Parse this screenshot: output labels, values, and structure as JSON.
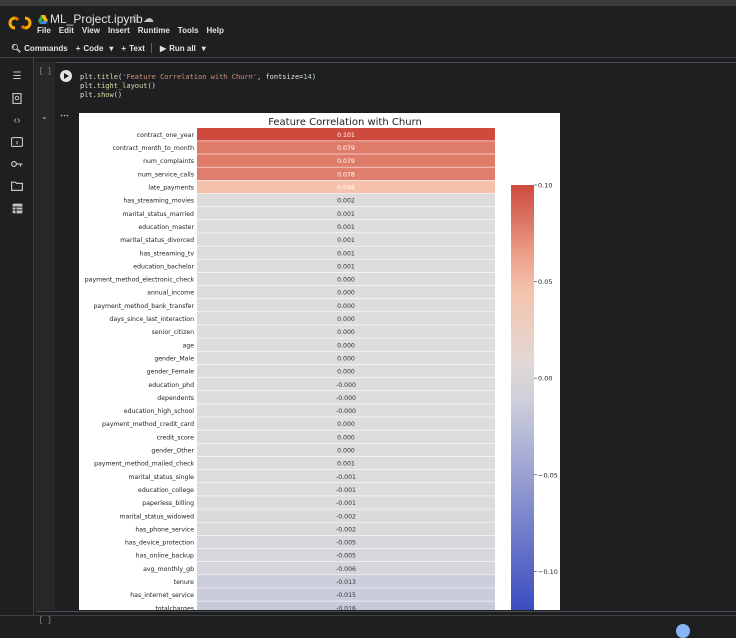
{
  "notebook": {
    "title": "ML_Project.ipynb"
  },
  "menu": [
    "File",
    "Edit",
    "View",
    "Insert",
    "Runtime",
    "Tools",
    "Help"
  ],
  "toolbar": {
    "commands": "Commands",
    "code": "Code",
    "text": "Text",
    "run_all": "Run all"
  },
  "sidebar_icons": [
    "table-of-contents-icon",
    "find-icon",
    "code-snippets-icon",
    "variables-icon",
    "secrets-icon",
    "files-icon",
    "terminal-icon"
  ],
  "cell": {
    "bracket": "[ ]",
    "code_lines": [
      "plt.title('Feature Correlation with Churn', fontsize=14)",
      "plt.tight_layout()",
      "plt.show()"
    ],
    "bottom_bracket": "[ ]"
  },
  "chart_data": {
    "type": "heatmap",
    "title": "Feature Correlation with Churn",
    "colorbar": {
      "min": -0.12,
      "max": 0.1,
      "ticks": [
        "0.10",
        "0.05",
        "0.00",
        "−0.05",
        "−0.10"
      ],
      "tick_values": [
        0.1,
        0.05,
        0.0,
        -0.05,
        -0.1
      ],
      "colormap": "coolwarm"
    },
    "rows": [
      {
        "label": "contract_one_year",
        "value": 0.101,
        "text": "0.101"
      },
      {
        "label": "contract_month_to_month",
        "value": 0.079,
        "text": "0.079"
      },
      {
        "label": "num_complaints",
        "value": 0.079,
        "text": "0.079"
      },
      {
        "label": "num_service_calls",
        "value": 0.078,
        "text": "0.078"
      },
      {
        "label": "late_payments",
        "value": 0.048,
        "text": "0.048"
      },
      {
        "label": "has_streaming_movies",
        "value": 0.002,
        "text": "0.002"
      },
      {
        "label": "marital_status_married",
        "value": 0.001,
        "text": "0.001"
      },
      {
        "label": "education_master",
        "value": 0.001,
        "text": "0.001"
      },
      {
        "label": "marital_status_divorced",
        "value": 0.001,
        "text": "0.001"
      },
      {
        "label": "has_streaming_tv",
        "value": 0.001,
        "text": "0.001"
      },
      {
        "label": "education_bachelor",
        "value": 0.001,
        "text": "0.001"
      },
      {
        "label": "payment_method_electronic_check",
        "value": 0.0,
        "text": "0.000"
      },
      {
        "label": "annual_income",
        "value": 0.0,
        "text": "0.000"
      },
      {
        "label": "payment_method_bank_transfer",
        "value": 0.0,
        "text": "0.000"
      },
      {
        "label": "days_since_last_interaction",
        "value": 0.0,
        "text": "0.000"
      },
      {
        "label": "senior_citizen",
        "value": 0.0,
        "text": "0.000"
      },
      {
        "label": "age",
        "value": 0.0,
        "text": "0.000"
      },
      {
        "label": "gender_Male",
        "value": 0.0,
        "text": "0.000"
      },
      {
        "label": "gender_Female",
        "value": 0.0,
        "text": "0.000"
      },
      {
        "label": "education_phd",
        "value": 0.0,
        "text": "-0.000"
      },
      {
        "label": "dependents",
        "value": 0.0,
        "text": "-0.000"
      },
      {
        "label": "education_high_school",
        "value": 0.0,
        "text": "-0.000"
      },
      {
        "label": "payment_method_credit_card",
        "value": 0.0,
        "text": "0.000"
      },
      {
        "label": "credit_score",
        "value": 0.0,
        "text": "0.000"
      },
      {
        "label": "gender_Other",
        "value": 0.0,
        "text": "0.000"
      },
      {
        "label": "payment_method_mailed_check",
        "value": -0.001,
        "text": "0.001"
      },
      {
        "label": "marital_status_single",
        "value": -0.001,
        "text": "-0.001"
      },
      {
        "label": "education_college",
        "value": -0.001,
        "text": "-0.001"
      },
      {
        "label": "paperless_billing",
        "value": -0.001,
        "text": "-0.001"
      },
      {
        "label": "marital_status_widowed",
        "value": -0.002,
        "text": "-0.002"
      },
      {
        "label": "has_phone_service",
        "value": -0.002,
        "text": "-0.002"
      },
      {
        "label": "has_device_protection",
        "value": -0.005,
        "text": "-0.005"
      },
      {
        "label": "has_online_backup",
        "value": -0.005,
        "text": "-0.005"
      },
      {
        "label": "avg_monthly_gb",
        "value": -0.006,
        "text": "-0.006"
      },
      {
        "label": "tenure",
        "value": -0.013,
        "text": "-0.013"
      },
      {
        "label": "has_internet_service",
        "value": -0.015,
        "text": "-0.015"
      },
      {
        "label": "totalcharges",
        "value": -0.016,
        "text": "-0.016"
      }
    ]
  }
}
